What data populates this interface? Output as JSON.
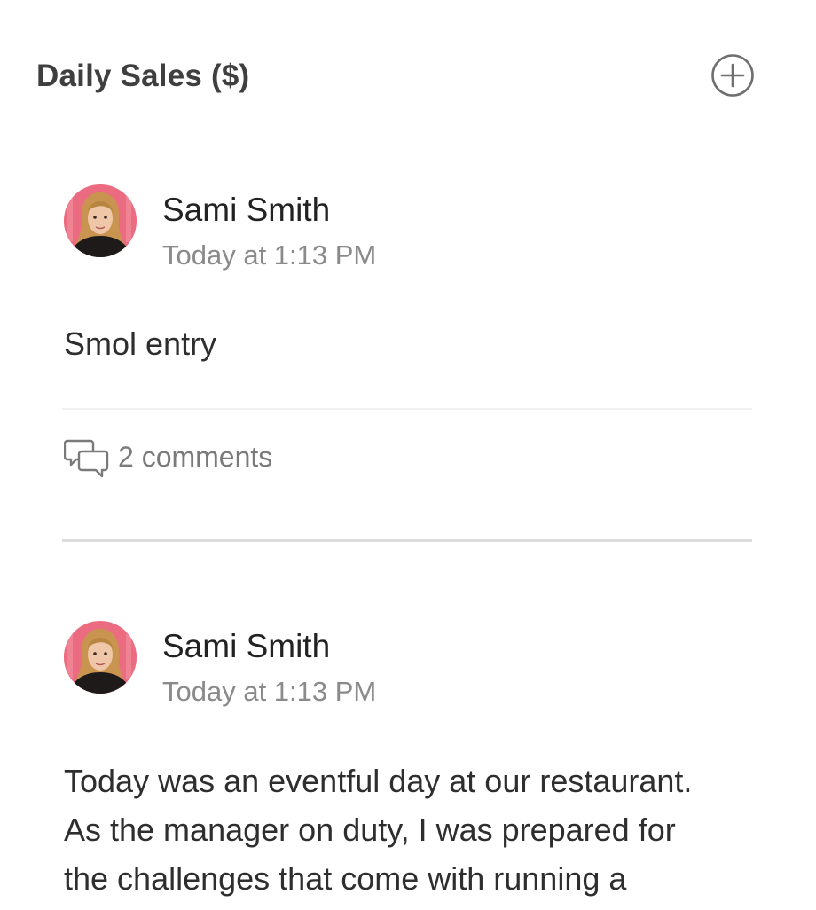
{
  "header": {
    "title": "Daily Sales ($)",
    "add_icon": "plus-circle-icon"
  },
  "entries": [
    {
      "author": "Sami Smith",
      "timestamp": "Today at 1:13 PM",
      "body": "Smol entry",
      "comments_label": "2 comments",
      "comments_icon": "speech-bubbles-icon"
    },
    {
      "author": "Sami Smith",
      "timestamp": "Today at 1:13 PM",
      "body_lines": [
        "Today was an eventful day at our restaurant.",
        "As the manager on duty, I was prepared for",
        "the challenges that come with running a"
      ]
    }
  ],
  "colors": {
    "title": "#3f3f3f",
    "meta": "#8a8a8a",
    "divider": "#dcdcdc"
  }
}
